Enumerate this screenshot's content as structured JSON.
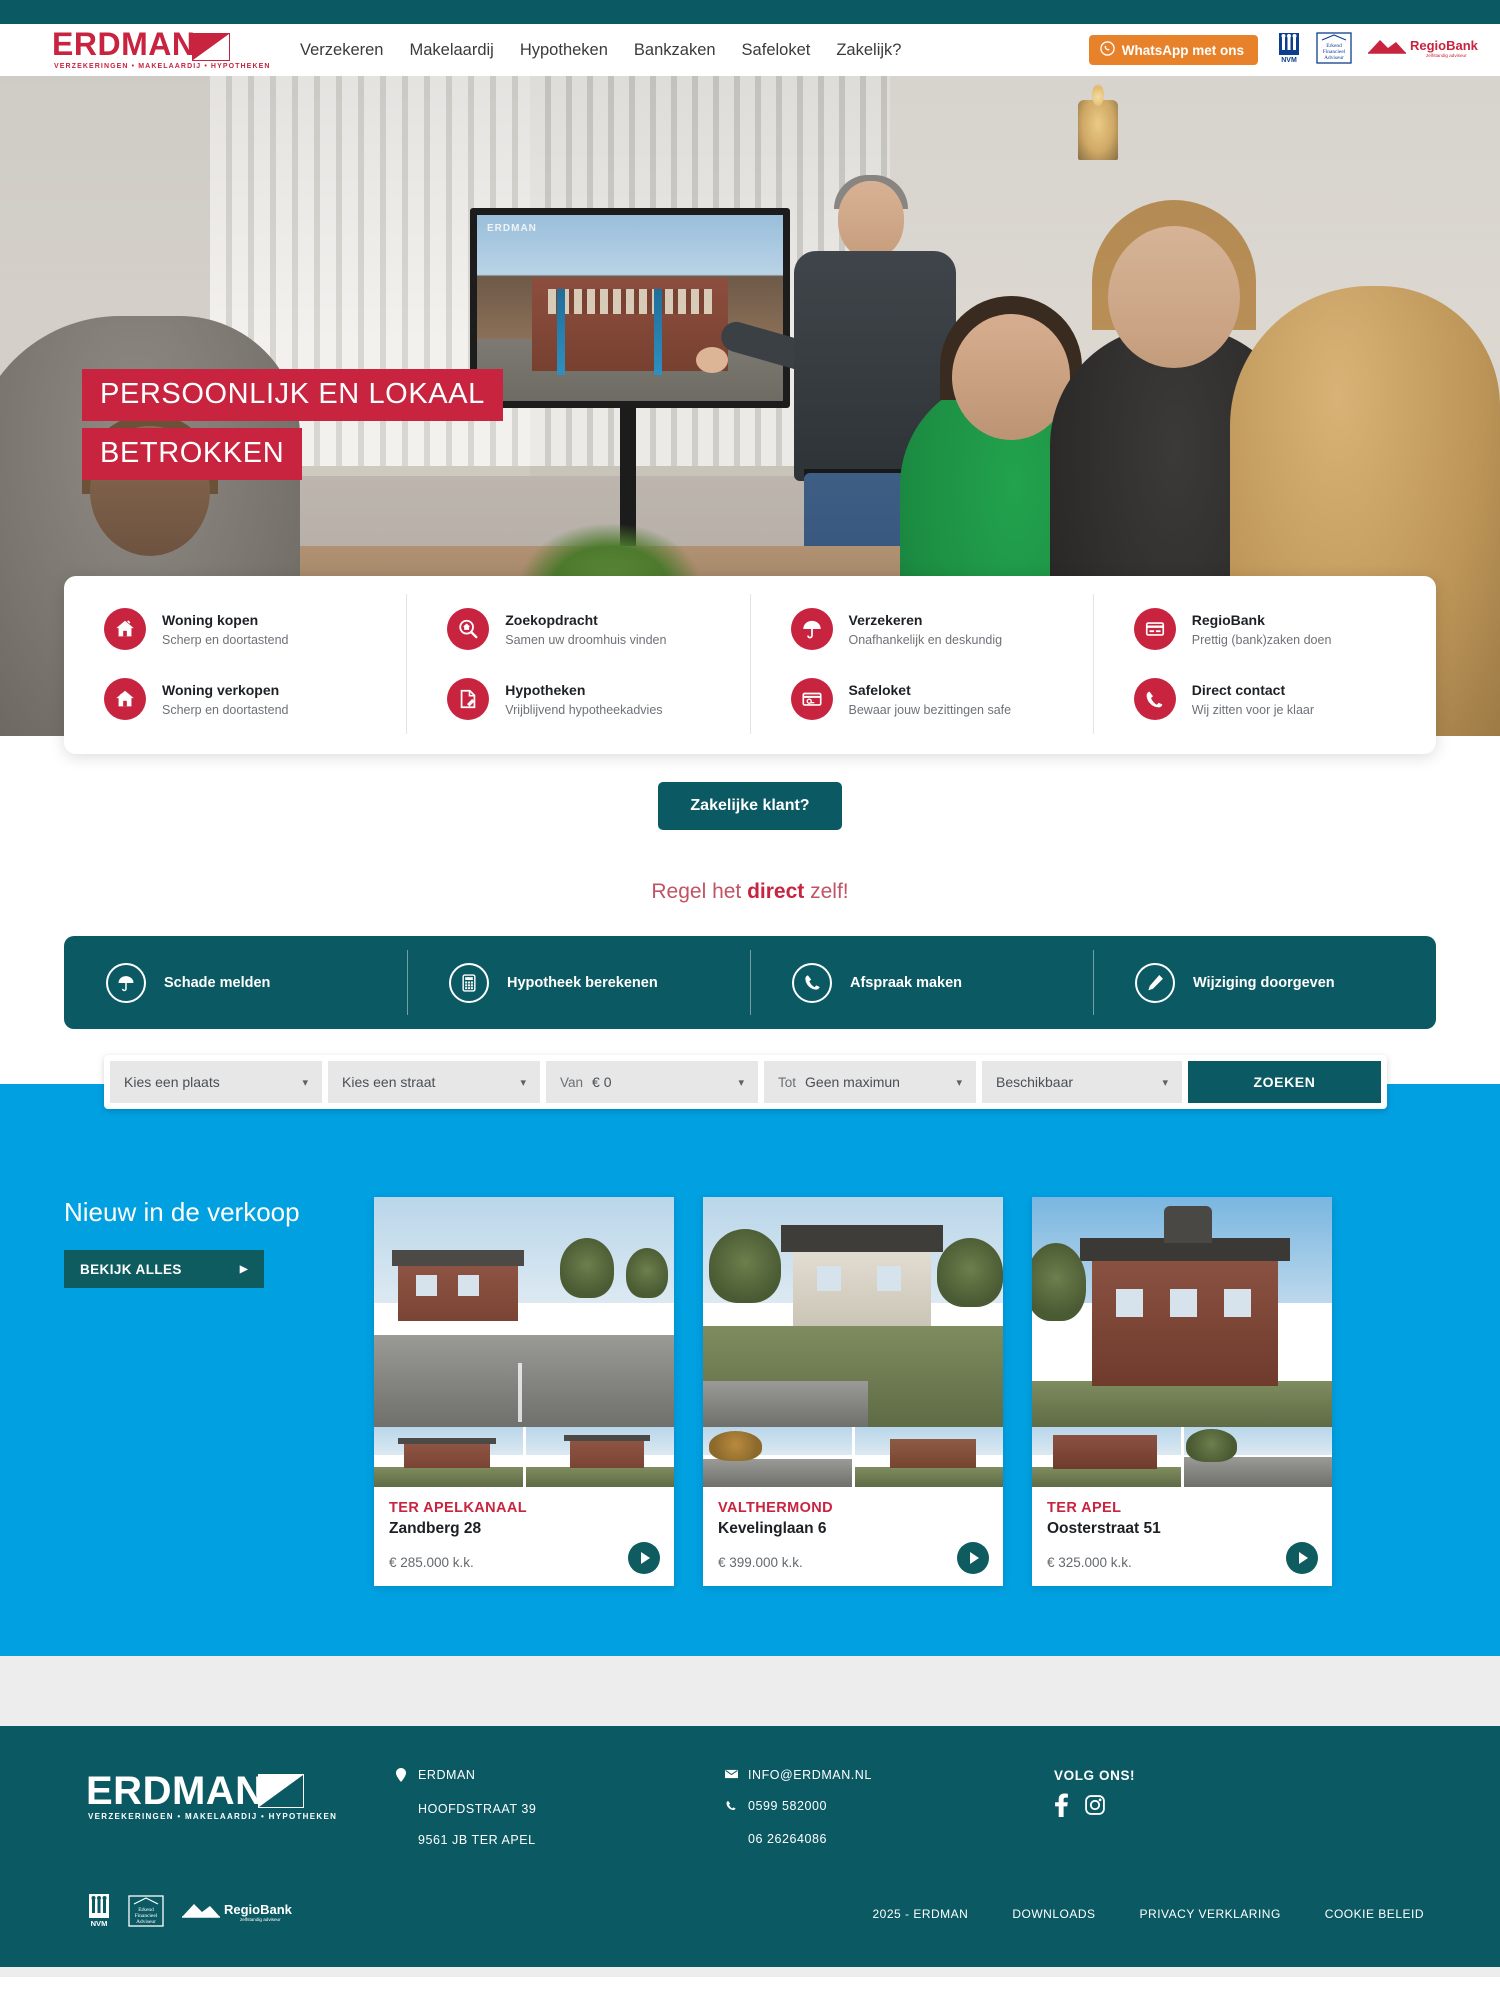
{
  "brand": {
    "name": "ERDMAN",
    "tagline": "VERZEKERINGEN • MAKELAARDIJ • HYPOTHEKEN",
    "colors": {
      "red": "#C8243F",
      "teal": "#0B5A63",
      "blue": "#00A0E1",
      "orange": "#E8822A"
    }
  },
  "header": {
    "nav": [
      {
        "label": "Verzekeren"
      },
      {
        "label": "Makelaardij"
      },
      {
        "label": "Hypotheken"
      },
      {
        "label": "Bankzaken"
      },
      {
        "label": "Safeloket"
      },
      {
        "label": "Zakelijk?"
      }
    ],
    "whatsapp_label": "WhatsApp met ons",
    "whatsapp_icon": "whatsapp-icon",
    "partners": [
      {
        "name": "NVM",
        "label": "NVM"
      },
      {
        "name": "Erkend Financieel Adviseur",
        "line1": "Erkend",
        "line2": "Financieel",
        "line3": "Adviseur"
      },
      {
        "name": "RegioBank",
        "label": "RegioBank",
        "sub": "zelfstandig adviseur"
      }
    ]
  },
  "hero": {
    "title_line1": "PERSOONLIJK EN LOKAAL",
    "title_line2": "BETROKKEN",
    "tv_logo": "ERDMAN"
  },
  "services": {
    "columns": [
      {
        "items": [
          {
            "title": "Woning kopen",
            "subtitle": "Scherp en doortastend",
            "icon": "house-buy-icon"
          },
          {
            "title": "Woning verkopen",
            "subtitle": "Scherp en doortastend",
            "icon": "house-sell-icon"
          }
        ]
      },
      {
        "items": [
          {
            "title": "Zoekopdracht",
            "subtitle": "Samen uw droomhuis vinden",
            "icon": "house-search-icon"
          },
          {
            "title": "Hypotheken",
            "subtitle": "Vrijblijvend hypotheekadvies",
            "icon": "document-sign-icon"
          }
        ]
      },
      {
        "items": [
          {
            "title": "Verzekeren",
            "subtitle": "Onafhankelijk en deskundig",
            "icon": "umbrella-icon"
          },
          {
            "title": "Safeloket",
            "subtitle": "Bewaar jouw bezittingen safe",
            "icon": "safe-card-icon"
          }
        ]
      },
      {
        "items": [
          {
            "title": "RegioBank",
            "subtitle": "Prettig (bank)zaken doen",
            "icon": "bank-card-icon"
          },
          {
            "title": "Direct contact",
            "subtitle": "Wij zitten voor je klaar",
            "icon": "phone-icon"
          }
        ]
      }
    ]
  },
  "business_cta": {
    "label": "Zakelijke klant?"
  },
  "self_service": {
    "heading_pre": "Regel het ",
    "heading_strong": "direct",
    "heading_post": " zelf!",
    "actions": [
      {
        "label": "Schade melden",
        "icon": "umbrella-outline-icon"
      },
      {
        "label": "Hypotheek berekenen",
        "icon": "calculator-outline-icon"
      },
      {
        "label": "Afspraak maken",
        "icon": "phone-outline-icon"
      },
      {
        "label": "Wijziging doorgeven",
        "icon": "pencil-outline-icon"
      }
    ]
  },
  "search": {
    "place": {
      "value": "Kies een plaats",
      "prefix": ""
    },
    "street": {
      "value": "Kies een straat",
      "prefix": ""
    },
    "from": {
      "prefix": "Van",
      "value": "€ 0"
    },
    "to": {
      "prefix": "Tot",
      "value": "Geen maximun"
    },
    "availability": {
      "value": "Beschikbaar",
      "prefix": ""
    },
    "submit_label": "ZOEKEN",
    "chevron": "chevron-down-icon"
  },
  "listings": {
    "heading": "Nieuw in de verkoop",
    "view_all_label": "BEKIJK ALLES",
    "cards": [
      {
        "city": "TER APELKANAAL",
        "address": "Zandberg 28",
        "price": "€ 285.000 k.k.",
        "cta": "play-icon"
      },
      {
        "city": "VALTHERMOND",
        "address": "Kevelinglaan 6",
        "price": "€ 399.000 k.k.",
        "cta": "play-icon"
      },
      {
        "city": "TER APEL",
        "address": "Oosterstraat 51",
        "price": "€ 325.000 k.k.",
        "cta": "play-icon"
      }
    ]
  },
  "footer": {
    "address": {
      "icon": "location-pin-icon",
      "lines": [
        "ERDMAN",
        "HOOFDSTRAAT 39",
        "9561 JB TER APEL"
      ]
    },
    "contact": [
      {
        "icon": "envelope-icon",
        "text": "INFO@ERDMAN.NL"
      },
      {
        "icon": "phone-icon",
        "text": "0599 582000"
      },
      {
        "icon": "",
        "text": "06 26264086"
      }
    ],
    "follow": {
      "title": "VOLG ONS!",
      "socials": [
        {
          "name": "facebook-icon",
          "label": "Facebook"
        },
        {
          "name": "instagram-icon",
          "label": "Instagram"
        }
      ]
    },
    "bottom": {
      "copyright": "2025 - ERDMAN",
      "links": [
        {
          "label": "DOWNLOADS"
        },
        {
          "label": "PRIVACY VERKLARING"
        },
        {
          "label": "COOKIE BELEID"
        }
      ],
      "partners": [
        {
          "name": "NVM",
          "label": "NVM"
        },
        {
          "name": "Erkend Financieel Adviseur",
          "line1": "Erkend",
          "line2": "Financieel",
          "line3": "Adviseur"
        },
        {
          "name": "RegioBank",
          "label": "RegioBank",
          "sub": "zelfstandig adviseur"
        }
      ]
    }
  }
}
